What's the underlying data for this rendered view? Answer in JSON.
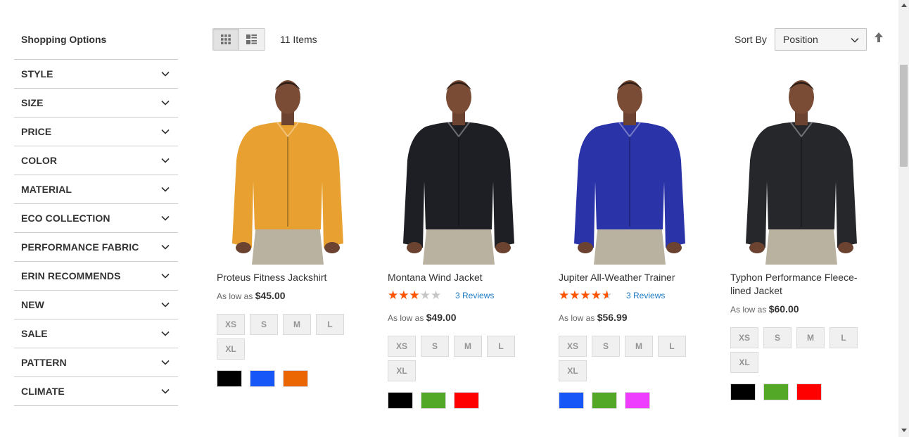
{
  "sidebar": {
    "title": "Shopping Options",
    "filters": [
      "Style",
      "Size",
      "Price",
      "Color",
      "Material",
      "Eco Collection",
      "Performance Fabric",
      "Erin Recommends",
      "New",
      "Sale",
      "Pattern",
      "Climate"
    ]
  },
  "toolbar": {
    "modes": [
      {
        "icon": "grid-icon",
        "active": true
      },
      {
        "icon": "list-icon",
        "active": false
      }
    ],
    "count": "11 Items",
    "sort_label": "Sort By",
    "sort_value": "Position",
    "sort_direction_icon": "arrow-up-icon"
  },
  "products": [
    {
      "name": "Proteus Fitness Jackshirt",
      "rating_percent": null,
      "reviews": "",
      "price_prefix": "As low as",
      "price": "$45.00",
      "sizes": [
        "XS",
        "S",
        "M",
        "L",
        "XL"
      ],
      "colors": [
        "#000000",
        "#1857f7",
        "#eb6703"
      ],
      "jacket_color": "#e8a030"
    },
    {
      "name": "Montana Wind Jacket",
      "rating_percent": 53,
      "reviews": "3 Reviews",
      "price_prefix": "As low as",
      "price": "$49.00",
      "sizes": [
        "XS",
        "S",
        "M",
        "L",
        "XL"
      ],
      "colors": [
        "#000000",
        "#53a828",
        "#ff0000"
      ],
      "jacket_color": "#1e1f24"
    },
    {
      "name": "Jupiter All-Weather Trainer",
      "rating_percent": 80,
      "reviews": "3 Reviews",
      "price_prefix": "As low as",
      "price": "$56.99",
      "sizes": [
        "XS",
        "S",
        "M",
        "L",
        "XL"
      ],
      "colors": [
        "#1857f7",
        "#53a828",
        "#ef3dff"
      ],
      "jacket_color": "#2a33a8"
    },
    {
      "name": "Typhon Performance Fleece-lined Jacket",
      "rating_percent": null,
      "reviews": "",
      "price_prefix": "As low as",
      "price": "$60.00",
      "sizes": [
        "XS",
        "S",
        "M",
        "L",
        "XL"
      ],
      "colors": [
        "#000000",
        "#53a828",
        "#ff0000"
      ],
      "jacket_color": "#26272b"
    }
  ]
}
